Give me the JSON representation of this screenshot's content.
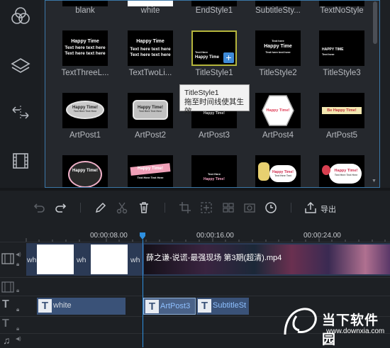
{
  "sidebar": {
    "icons": [
      "filters-icon",
      "overlays-icon",
      "transitions-icon",
      "media-icon"
    ]
  },
  "grid": {
    "row1_captions": [
      "blank",
      "white",
      "EndStyle1",
      "SubtitleSty...",
      "TextNoStyle"
    ],
    "row2": [
      {
        "caption": "TextThreeL...",
        "lines": [
          "Happy Time",
          "Text here text here",
          "Text here text here"
        ]
      },
      {
        "caption": "TextTwoLi...",
        "lines": [
          "Happy Time",
          "Text here text here",
          "Text here text here"
        ]
      },
      {
        "caption": "TitleStyle1",
        "lines": [
          "Text Here",
          "Happy Time"
        ]
      },
      {
        "caption": "TitleStyle2",
        "lines": [
          "Text here",
          "Happy Time",
          "Text here text here"
        ]
      },
      {
        "caption": "TitleStyle3",
        "lines": [
          "HAPPY TIME",
          "Text here"
        ]
      }
    ],
    "row3": [
      {
        "caption": "ArtPost1",
        "lines": [
          "Happy Time!",
          "Text Here Text Here"
        ]
      },
      {
        "caption": "ArtPost2",
        "lines": [
          "Happy Time!",
          "Text Here Text Here"
        ]
      },
      {
        "caption": "ArtPost3",
        "lines": [
          "Happy Time!"
        ]
      },
      {
        "caption": "ArtPost4",
        "lines": [
          "Happy Time!"
        ]
      },
      {
        "caption": "ArtPost5",
        "lines": [
          "Be Happy Time!"
        ]
      }
    ],
    "row4": [
      {
        "lines": [
          "Happy Time!"
        ]
      },
      {
        "lines": [
          "Happy Time!",
          "Text Here Text Here"
        ]
      },
      {
        "lines": [
          "Text Here",
          "Happy Time!"
        ]
      },
      {
        "lines": [
          "Happy Time!",
          "Text Here Text"
        ]
      },
      {
        "lines": [
          "Happy Time!",
          "Text Here Text Here"
        ]
      }
    ],
    "selected": "TitleStyle1",
    "add_icon": "plus-icon"
  },
  "tooltip": {
    "title": "TitleStyle1",
    "hint": "拖至时间线使其生效"
  },
  "toolbar": {
    "icons": [
      "undo-icon",
      "redo-icon",
      "edit-icon",
      "cut-icon",
      "delete-icon",
      "crop-icon",
      "zoom-icon",
      "mosaic-icon",
      "snapshot-icon",
      "duration-icon",
      "export-icon"
    ],
    "export_label": "导出"
  },
  "timeline": {
    "ruler_labels": [
      "00:00:08.00",
      "00:00:16.00",
      "00:00:24.00"
    ],
    "video_track": {
      "clip_labels": [
        "wh",
        "wh",
        "wh"
      ],
      "video_title": "薛之谦-说谎-最强现场 第3期(超清).mp4"
    },
    "text_clips": [
      "white",
      "ArtPost3",
      "SubtitleSt"
    ]
  },
  "watermark": {
    "name": "当下软件园",
    "url": "www.downxia.com"
  },
  "colors": {
    "accent": "#2e90e0",
    "selection": "#b5b53c",
    "text_clip": "#3a5278"
  }
}
